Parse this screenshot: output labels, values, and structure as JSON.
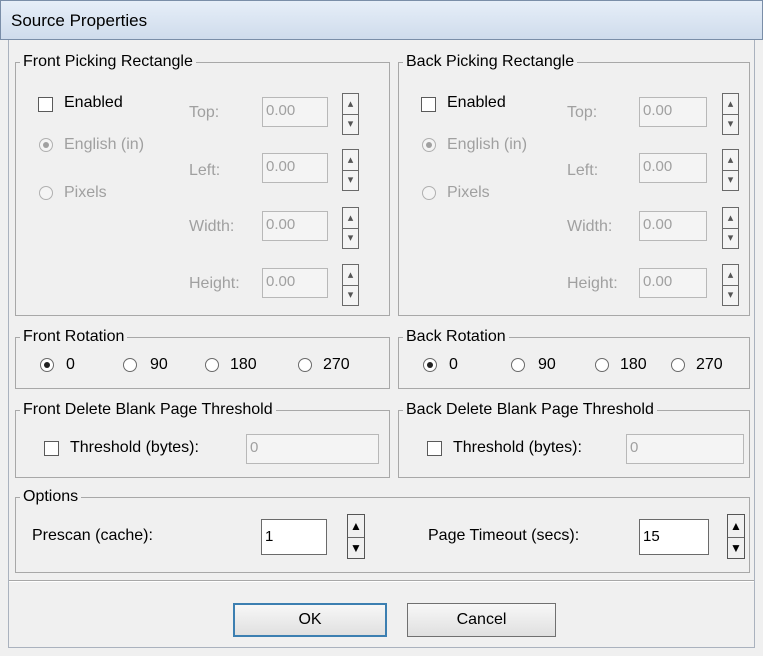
{
  "window": {
    "title": "Source Properties"
  },
  "front_picking": {
    "legend": "Front Picking Rectangle",
    "enabled_label": "Enabled",
    "enabled_checked": false,
    "english_label": "English (in)",
    "pixels_label": "Pixels",
    "top_label": "Top:",
    "left_label": "Left:",
    "width_label": "Width:",
    "height_label": "Height:",
    "top_value": "0.00",
    "left_value": "0.00",
    "width_value": "0.00",
    "height_value": "0.00"
  },
  "back_picking": {
    "legend": "Back Picking Rectangle",
    "enabled_label": "Enabled",
    "enabled_checked": false,
    "english_label": "English (in)",
    "pixels_label": "Pixels",
    "top_label": "Top:",
    "left_label": "Left:",
    "width_label": "Width:",
    "height_label": "Height:",
    "top_value": "0.00",
    "left_value": "0.00",
    "width_value": "0.00",
    "height_value": "0.00"
  },
  "front_rotation": {
    "legend": "Front Rotation",
    "options": [
      "0",
      "90",
      "180",
      "270"
    ],
    "selected": "0"
  },
  "back_rotation": {
    "legend": "Back Rotation",
    "options": [
      "0",
      "90",
      "180",
      "270"
    ],
    "selected": "0"
  },
  "front_blank": {
    "legend": "Front Delete Blank Page Threshold",
    "label": "Threshold (bytes):",
    "value": "0"
  },
  "back_blank": {
    "legend": "Back Delete Blank Page Threshold",
    "label": "Threshold (bytes):",
    "value": "0"
  },
  "options": {
    "legend": "Options",
    "prescan_label": "Prescan (cache):",
    "prescan_value": "1",
    "timeout_label": "Page Timeout (secs):",
    "timeout_value": "15"
  },
  "buttons": {
    "ok": "OK",
    "cancel": "Cancel"
  },
  "icons": {
    "spin_up": "up-arrow-icon",
    "spin_down": "down-arrow-icon"
  },
  "colors": {
    "disabled_text": "#a0a0a0",
    "default_button_border": "#3c7fb1",
    "title_bar": "#dbe6f3"
  }
}
